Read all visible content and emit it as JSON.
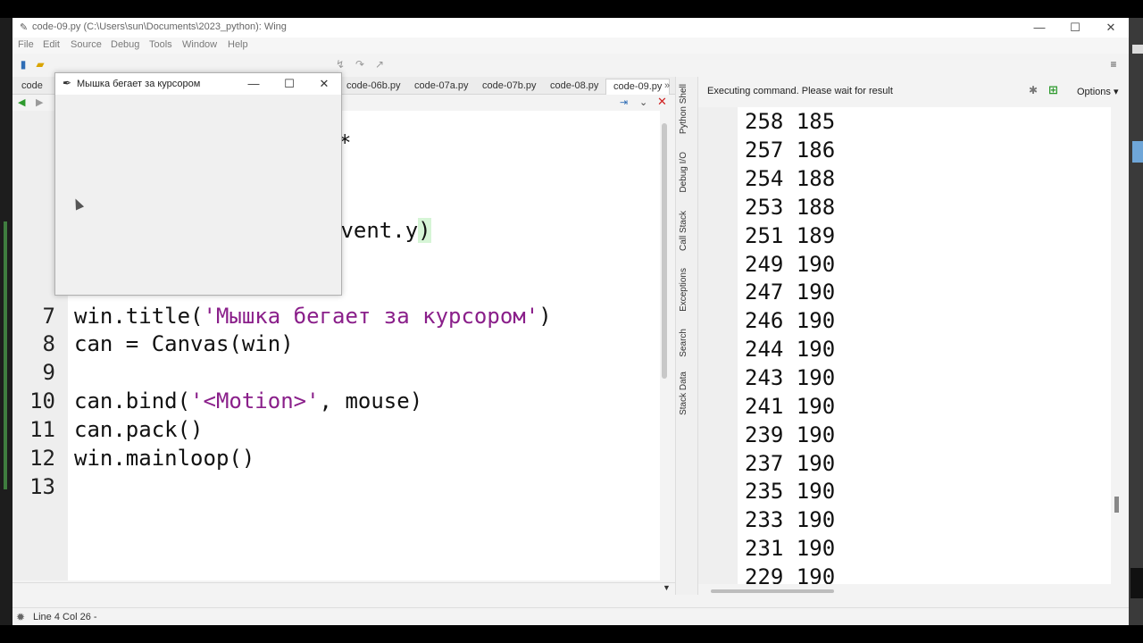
{
  "window": {
    "title": "code-09.py (C:\\Users\\sun\\Documents\\2023_python): Wing",
    "min": "—",
    "max": "☐",
    "close": "✕"
  },
  "menu": [
    "File",
    "Edit",
    "Source",
    "Debug",
    "Tools",
    "Window",
    "Help"
  ],
  "tabs": [
    {
      "label": "code"
    },
    {
      "label": "code-06b.py"
    },
    {
      "label": "code-07a.py"
    },
    {
      "label": "code-07b.py"
    },
    {
      "label": "code-08.py"
    },
    {
      "label": "code-09.py",
      "active": true
    }
  ],
  "editor": {
    "partial_lines": [
      {
        "text": "*"
      },
      {
        "text": "event.y",
        "bracket": ")"
      },
      {
        "text": "()"
      }
    ],
    "lines": [
      {
        "n": "7",
        "pre": "win.title(",
        "str": "'Мышка бегает за курсором'",
        "post": ")"
      },
      {
        "n": "8",
        "pre": "can = Canvas(win)",
        "str": "",
        "post": ""
      },
      {
        "n": "9",
        "pre": "",
        "str": "",
        "post": ""
      },
      {
        "n": "10",
        "pre": "can.bind(",
        "str": "'<Motion>'",
        "post": ", mouse)"
      },
      {
        "n": "11",
        "pre": "can.pack()",
        "str": "",
        "post": ""
      },
      {
        "n": "12",
        "pre": "win.mainloop()",
        "str": "",
        "post": ""
      },
      {
        "n": "13",
        "pre": "",
        "str": "",
        "post": ""
      }
    ]
  },
  "sidetabs": [
    "Python Shell",
    "Debug I/O",
    "Call Stack",
    "Exceptions",
    "Search",
    "Stack Data"
  ],
  "shell": {
    "status": "Executing command.  Please wait for result",
    "options": "Options",
    "output": [
      "258 185",
      "257 186",
      "254 188",
      "253 188",
      "251 189",
      "249 190",
      "247 190",
      "246 190",
      "244 190",
      "243 190",
      "241 190",
      "239 190",
      "237 190",
      "235 190",
      "233 190",
      "231 190",
      "229 190"
    ]
  },
  "status": {
    "text": "Line 4 Col 26 -"
  },
  "popup": {
    "title": "Мышка бегает за курсором",
    "min": "—",
    "max": "☐",
    "close": "✕"
  }
}
